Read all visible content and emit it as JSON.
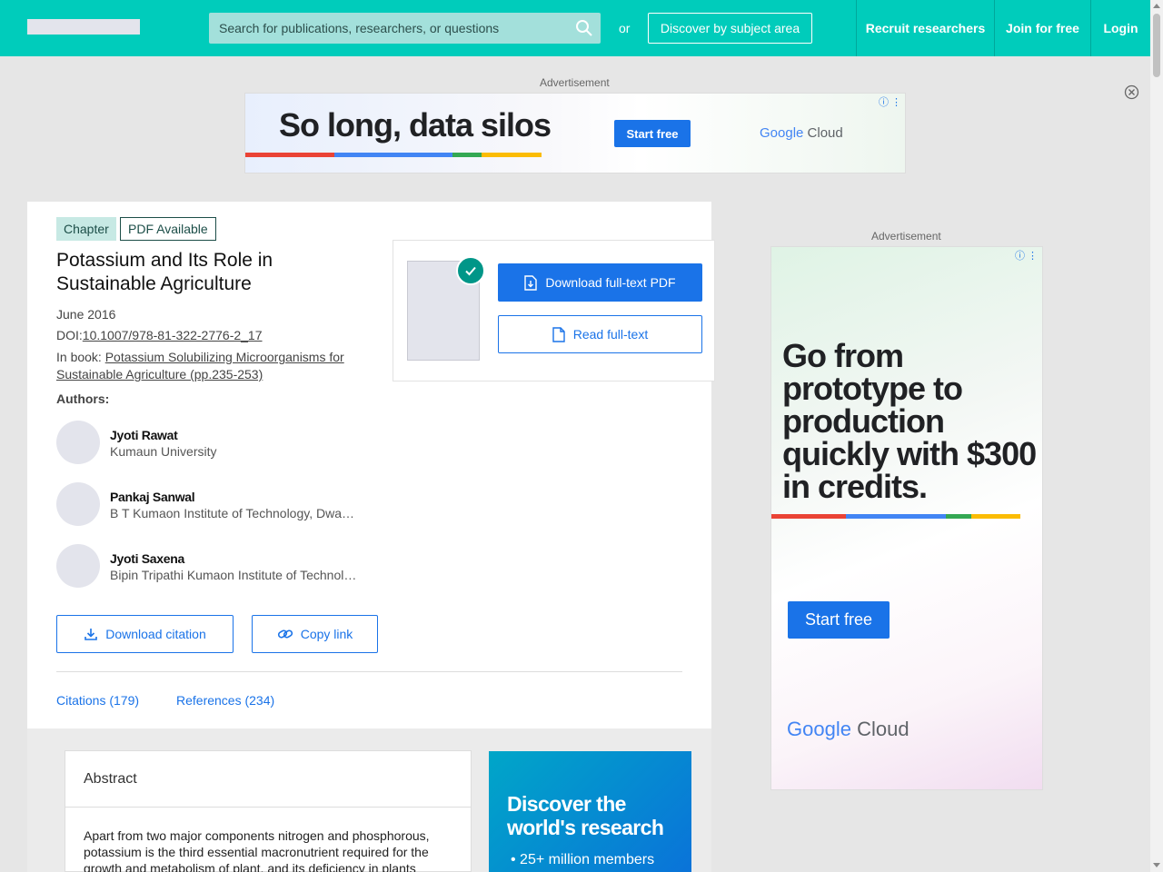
{
  "header": {
    "search_placeholder": "Search for publications, researchers, or questions",
    "or_text": "or",
    "discover_label": "Discover by subject area",
    "nav": [
      "Recruit researchers",
      "Join for free",
      "Login"
    ]
  },
  "ads": {
    "label": "Advertisement",
    "top": {
      "slogan": "So long, data silos",
      "cta": "Start free",
      "brand_google": "Google",
      "brand_cloud": "Cloud"
    },
    "side": {
      "headline": "Go from prototype to production quickly with $300 in credits.",
      "cta": "Start free",
      "brand_google": "Google",
      "brand_cloud": "Cloud"
    }
  },
  "publication": {
    "tags": [
      "Chapter",
      "PDF Available"
    ],
    "title": "Potassium and Its Role in Sustainable Agriculture",
    "date": "June 2016",
    "doi_label": "DOI:",
    "doi": "10.1007/978-81-322-2776-2_17",
    "book_label": "In book: ",
    "book": "Potassium Solubilizing Microorganisms for Sustainable Agriculture (pp.235-253)",
    "authors_label": "Authors:",
    "authors": [
      {
        "name": "Jyoti Rawat",
        "affiliation": "Kumaun University"
      },
      {
        "name": "Pankaj Sanwal",
        "affiliation": "B T Kumaon Institute of Technology, Dwarahat"
      },
      {
        "name": "Jyoti Saxena",
        "affiliation": "Bipin Tripathi Kumaon Institute of Technology"
      }
    ],
    "download_citation": "Download citation",
    "copy_link": "Copy link",
    "tabs": [
      "Citations (179)",
      "References (234)"
    ]
  },
  "download_box": {
    "download_pdf": "Download full-text PDF",
    "read_fulltext": "Read full-text"
  },
  "abstract": {
    "heading": "Abstract",
    "text": "Apart from two major components nitrogen and phosphorous, potassium is the third essential macronutrient required for the growth and metabolism of plant, and its deficiency in plants"
  },
  "promo": {
    "heading": "Discover the world's research",
    "bullet": "25+ million members"
  },
  "colors": {
    "brand": "#00ccbb",
    "accent": "#1a73e8",
    "check": "#009688",
    "google_red": "#ea4335",
    "google_blue": "#4285f4",
    "google_green": "#34a853",
    "google_yellow": "#fbbc04"
  }
}
